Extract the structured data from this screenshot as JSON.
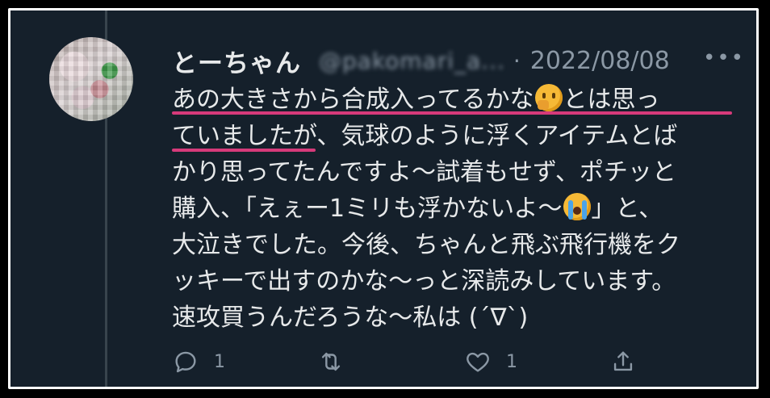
{
  "tweet": {
    "display_name": "とーちゃん",
    "handle": "@pakomari_a...",
    "separator": "·",
    "date": "2022/08/08",
    "more_icon": "•••",
    "body_lines": [
      [
        "あの大きさから合成入ってるかな",
        "とは思っ"
      ],
      [
        "ていましたが、気球のように浮くアイテムとば"
      ],
      [
        "かり思ってたんですよ〜試着もせず、ポチッと"
      ],
      [
        "購入、「えぇー1ミリも浮かないよ〜",
        "」と、"
      ],
      [
        "大泣きでした。今後、ちゃんと飛ぶ飛行機をク"
      ],
      [
        "ッキーで出すのかな〜っと深読みしています。"
      ],
      [
        "速攻買うんだろうな〜私は (´∇`)"
      ]
    ],
    "emojis": [
      "thinking-face",
      "loudly-crying-face"
    ],
    "highlight_color": "#d63a7a"
  },
  "actions": {
    "reply_count": "1",
    "retweet_count": "",
    "like_count": "1",
    "share_count": ""
  },
  "colors": {
    "background": "#15202b",
    "text": "#e7e9ea",
    "muted": "#8b98a5",
    "frame": "#ffffff"
  }
}
